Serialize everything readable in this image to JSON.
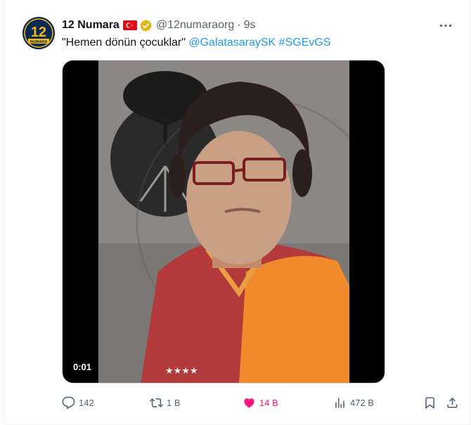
{
  "tweet": {
    "author_name": "12 Numara",
    "handle": "@12numaraorg",
    "separator": "·",
    "time": "9s",
    "text_quote": "\"Hemen dönün çocuklar\"",
    "mention": "@GalatasaraySK",
    "hashtag": "#SGEvGS"
  },
  "avatar": {
    "logo_text": "12",
    "sub_text": "NUMARA",
    "bg_color": "#0a2a55",
    "accent_color": "#f5b915"
  },
  "media": {
    "timestamp": "0:01"
  },
  "actions": {
    "replies": "142",
    "retweets": "1 B",
    "likes": "14 B",
    "views": "472 B"
  },
  "colors": {
    "link": "#1d9bf0",
    "secondary": "#536471",
    "like": "#f91880",
    "verified": "#e2b719"
  },
  "icons": [
    "flag-turkey-icon",
    "verified-badge-icon",
    "more-icon",
    "reply-icon",
    "retweet-icon",
    "like-icon",
    "views-icon",
    "bookmark-icon",
    "share-icon"
  ]
}
